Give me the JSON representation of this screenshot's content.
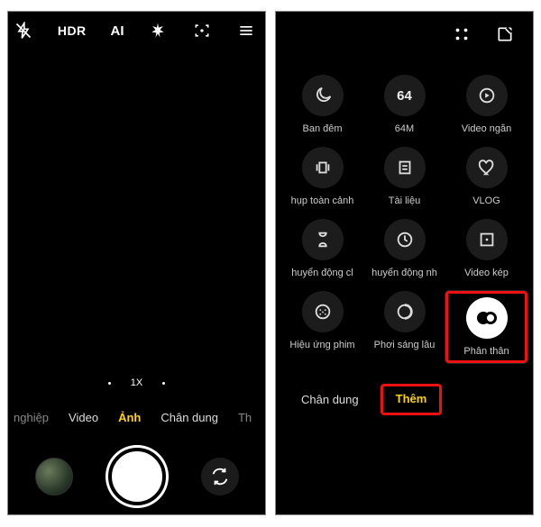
{
  "left": {
    "top": {
      "hdr": "HDR",
      "ai": "AI"
    },
    "zoom": "1X",
    "modes": {
      "pro": "nghiệp",
      "video": "Video",
      "photo": "Ảnh",
      "portrait": "Chân dung",
      "extra": "Th"
    }
  },
  "right": {
    "grid": [
      {
        "key": "night",
        "label": "Ban đêm"
      },
      {
        "key": "64m",
        "label": "64M",
        "text": "64"
      },
      {
        "key": "shortvideo",
        "label": "Video ngắn"
      },
      {
        "key": "panorama",
        "label": "hụp toàn cảnh"
      },
      {
        "key": "documents",
        "label": "Tài liệu"
      },
      {
        "key": "vlog",
        "label": "VLOG"
      },
      {
        "key": "slowmo",
        "label": "huyển động cl"
      },
      {
        "key": "timelapse",
        "label": "huyển động nh"
      },
      {
        "key": "dualvideo",
        "label": "Video kép"
      },
      {
        "key": "movieeffects",
        "label": "Hiệu ứng phim"
      },
      {
        "key": "longexposure",
        "label": "Phơi sáng lâu"
      },
      {
        "key": "clone",
        "label": "Phân thân"
      }
    ],
    "modes": {
      "portrait": "Chân dung",
      "more": "Thêm"
    }
  }
}
